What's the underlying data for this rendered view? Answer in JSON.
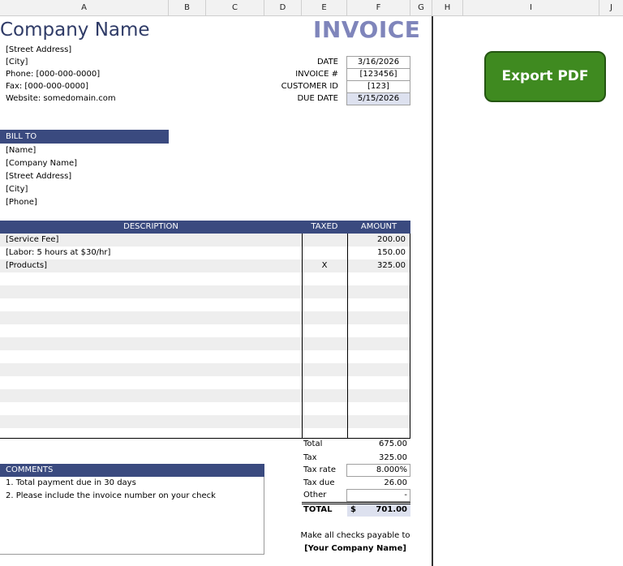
{
  "columns": [
    "A",
    "B",
    "C",
    "D",
    "E",
    "F",
    "G",
    "H",
    "I",
    "J"
  ],
  "company": {
    "name": "Company Name",
    "street": "[Street Address]",
    "city": "[City]",
    "phone": "Phone: [000-000-0000]",
    "fax": "Fax: [000-000-0000]",
    "website": "Website: somedomain.com"
  },
  "invoice_title": "INVOICE",
  "meta": [
    {
      "label": "DATE",
      "value": "3/16/2026"
    },
    {
      "label": "INVOICE #",
      "value": "[123456]"
    },
    {
      "label": "CUSTOMER ID",
      "value": "[123]"
    },
    {
      "label": "DUE DATE",
      "value": "5/15/2026"
    }
  ],
  "bill_to": {
    "header": "BILL TO",
    "lines": [
      "[Name]",
      "[Company Name]",
      "[Street Address]",
      "[City]",
      "[Phone]"
    ]
  },
  "items": {
    "headers": {
      "description": "DESCRIPTION",
      "taxed": "TAXED",
      "amount": "AMOUNT"
    },
    "rows": [
      {
        "description": "[Service Fee]",
        "taxed": "",
        "amount": "200.00"
      },
      {
        "description": "[Labor: 5 hours at $30/hr]",
        "taxed": "",
        "amount": "150.00"
      },
      {
        "description": "[Products]",
        "taxed": "X",
        "amount": "325.00"
      }
    ]
  },
  "totals": {
    "total_label": "Total",
    "total_value": "675.00",
    "tax_label": "Tax",
    "tax_value": "325.00",
    "taxrate_label": "Tax rate",
    "taxrate_value": "8.000%",
    "taxdue_label": "Tax due",
    "taxdue_value": "26.00",
    "other_label": "Other",
    "other_value": "-",
    "grand_label": "TOTAL",
    "grand_currency": "$",
    "grand_value": "701.00"
  },
  "comments": {
    "header": "COMMENTS",
    "lines": [
      "1. Total payment due in 30 days",
      "2. Please include the invoice number on your check"
    ]
  },
  "footer": {
    "line1": "Make all checks payable to",
    "line2": "[Your Company Name]"
  },
  "export_button": "Export PDF",
  "colors": {
    "header_bar": "#3a4a7f",
    "title": "#7f85bb",
    "company": "#2f3b67",
    "button": "#3f8a20"
  }
}
